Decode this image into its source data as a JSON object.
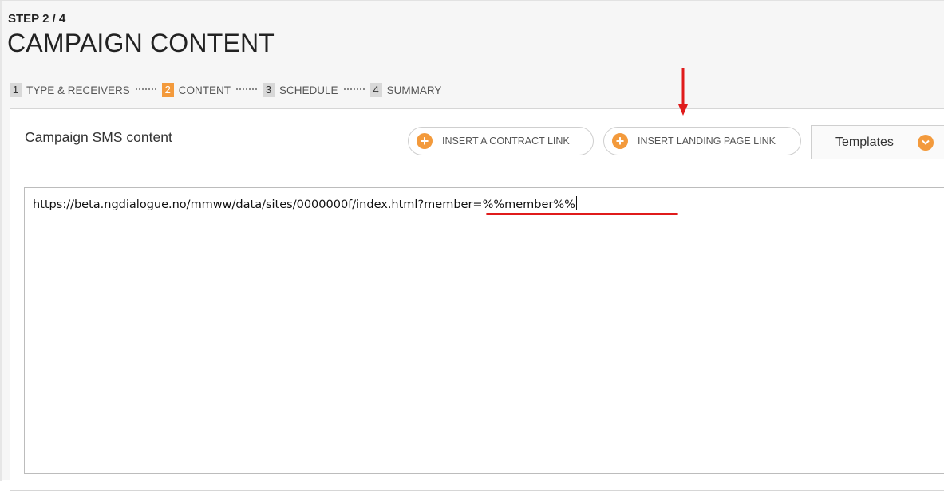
{
  "header": {
    "step": "STEP 2 / 4",
    "title": "CAMPAIGN CONTENT"
  },
  "wizard": {
    "steps": [
      {
        "num": "1",
        "label": "TYPE & RECEIVERS",
        "active": false
      },
      {
        "num": "2",
        "label": "CONTENT",
        "active": true
      },
      {
        "num": "3",
        "label": "SCHEDULE",
        "active": false
      },
      {
        "num": "4",
        "label": "SUMMARY",
        "active": false
      }
    ]
  },
  "panel": {
    "title": "Campaign SMS content",
    "insert_contract_label": "INSERT A CONTRACT LINK",
    "insert_landing_label": "INSERT LANDING PAGE LINK",
    "templates_label": "Templates",
    "sms_content": "https://beta.ngdialogue.no/mmww/data/sites/0000000f/index.html?member=%%member%%"
  },
  "colors": {
    "accent": "#f39a3c",
    "annotation": "#e01b1b"
  },
  "icons": {
    "plus": "plus-circle-icon",
    "chevron": "chevron-down-icon",
    "annotation_arrow": "red-arrow-down"
  }
}
